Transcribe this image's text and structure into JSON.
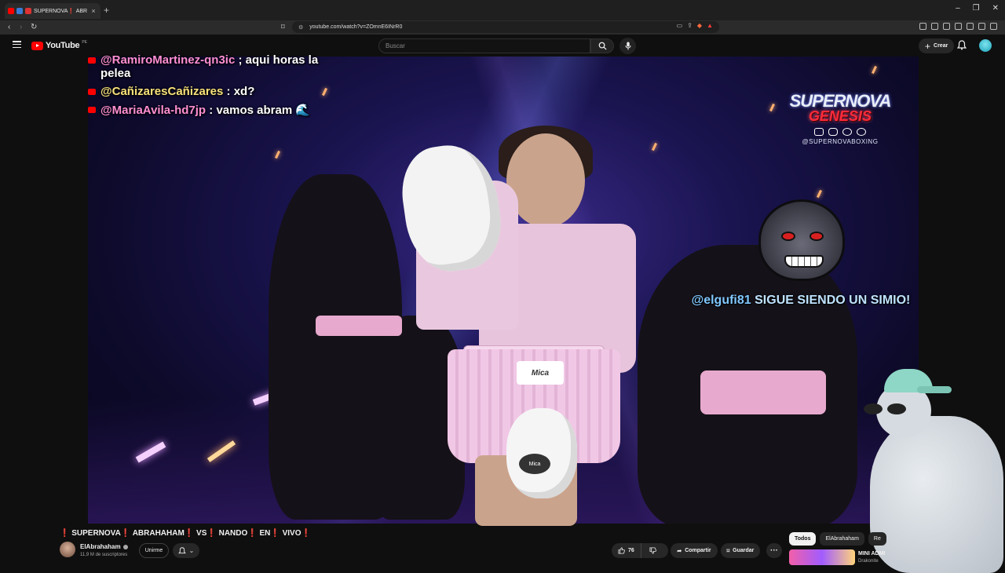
{
  "browser": {
    "tab_title": "SUPERNOVA❗ ABRAHAHAM❗",
    "url": "youtube.com/watch?v=ZOmnE6INrR0",
    "new_tab_symbol": "+",
    "tab_close_symbol": "×"
  },
  "header": {
    "logo_text": "YouTube",
    "logo_country": "PE",
    "search_placeholder": "Buscar",
    "create_label": "Crear"
  },
  "overlay": {
    "chat": [
      {
        "user": "@RamiroMartinez-qn3ic",
        "msg": " ; aqui horas la pelea"
      },
      {
        "user": "@CañizaresCañizares",
        "msg": " : xd?"
      },
      {
        "user": "@MariaAvila-hd7jp",
        "msg": " : vamos abram 🌊"
      }
    ],
    "event_logo_line1": "SUPERNOVA",
    "event_logo_line2": "GENESIS",
    "event_handle": "@SUPERNOVABOXING",
    "skirt_text": "Mica",
    "glove_text": "Mica",
    "donation_name": "@elgufi81",
    "donation_message": "SIGUE SIENDO UN SIMIO!"
  },
  "video": {
    "title": "❗ SUPERNOVA❗ ABRAHAHAM❗ VS❗ NANDO❗ EN❗ VIVO❗",
    "channel_name": "ElAbrahaham",
    "subscribers": "11,9 M de suscriptores",
    "join_label": "Unirme",
    "likes": "76",
    "share_label": "Compartir",
    "save_label": "Guardar",
    "more_label": "···"
  },
  "sidebar": {
    "chips": [
      "Todos",
      "ElAbrahaham",
      "Re"
    ],
    "rec_title": "MINI ADMI",
    "rec_channel": "Drakonite"
  }
}
